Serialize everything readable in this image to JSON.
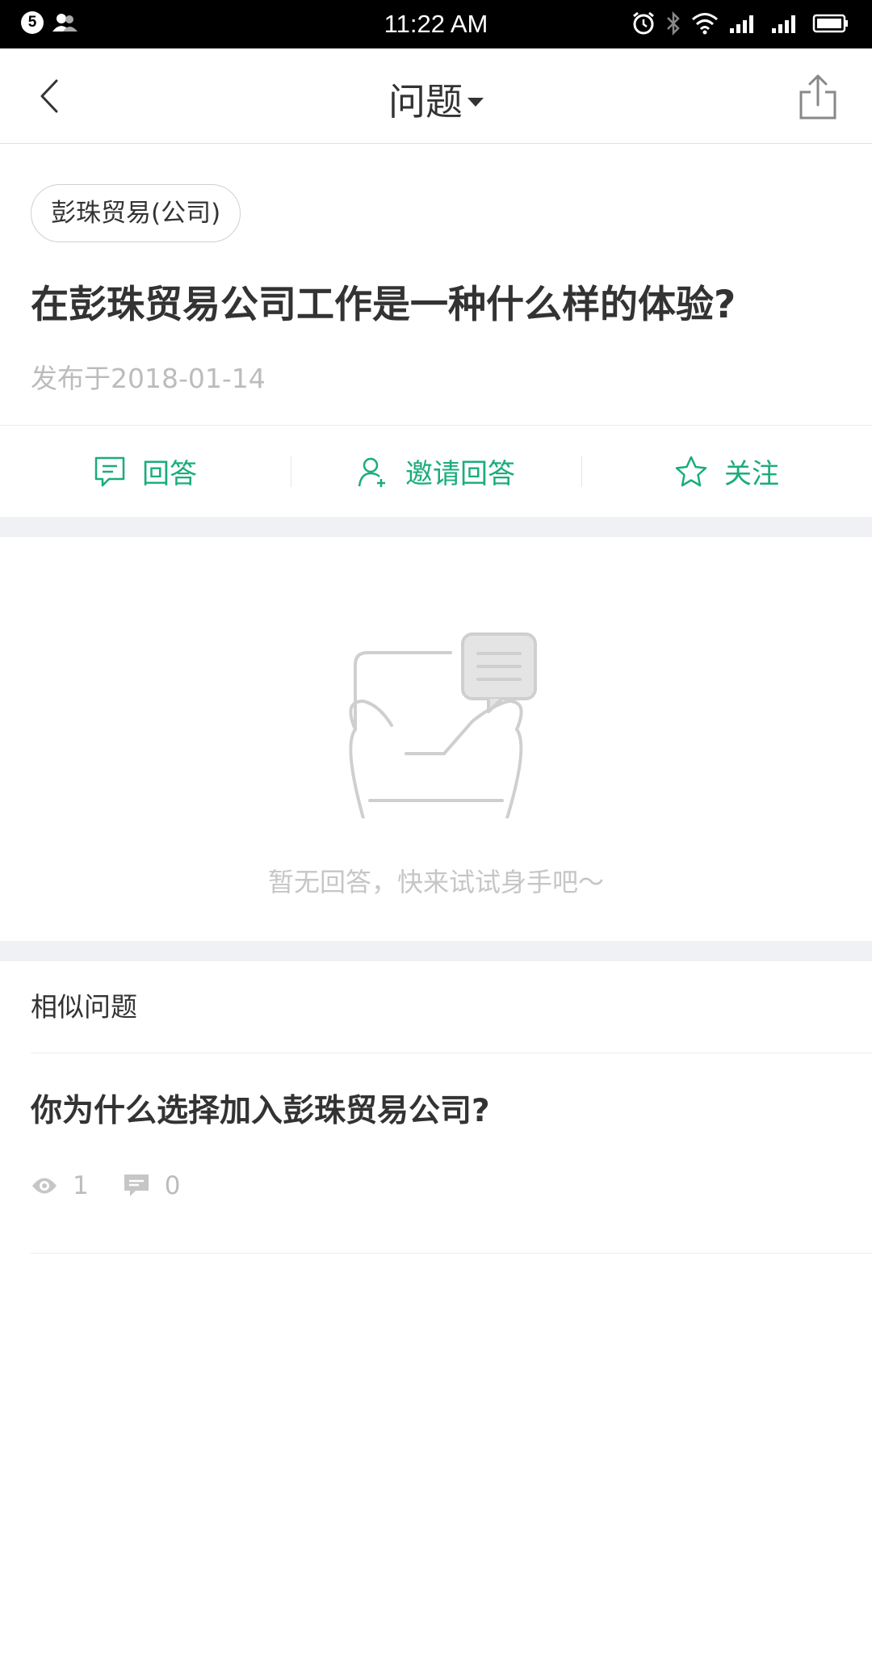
{
  "status_bar": {
    "notification_count": "5",
    "time": "11:22 AM"
  },
  "nav": {
    "title": "问题"
  },
  "question": {
    "tag": "彭珠贸易(公司)",
    "title": "在彭珠贸易公司工作是一种什么样的体验?",
    "date": "发布于2018-01-14"
  },
  "actions": [
    {
      "label": "回答",
      "icon": "chat-bubble-icon"
    },
    {
      "label": "邀请回答",
      "icon": "invite-user-icon"
    },
    {
      "label": "关注",
      "icon": "star-icon"
    }
  ],
  "empty_state": {
    "text": "暂无回答，快来试试身手吧～"
  },
  "similar": {
    "header": "相似问题",
    "items": [
      {
        "title": "你为什么选择加入彭珠贸易公司?",
        "views": "1",
        "comments": "0"
      }
    ]
  },
  "colors": {
    "accent": "#1aad7a",
    "muted": "#bcbcbc",
    "divider_band": "#eff1f4"
  }
}
